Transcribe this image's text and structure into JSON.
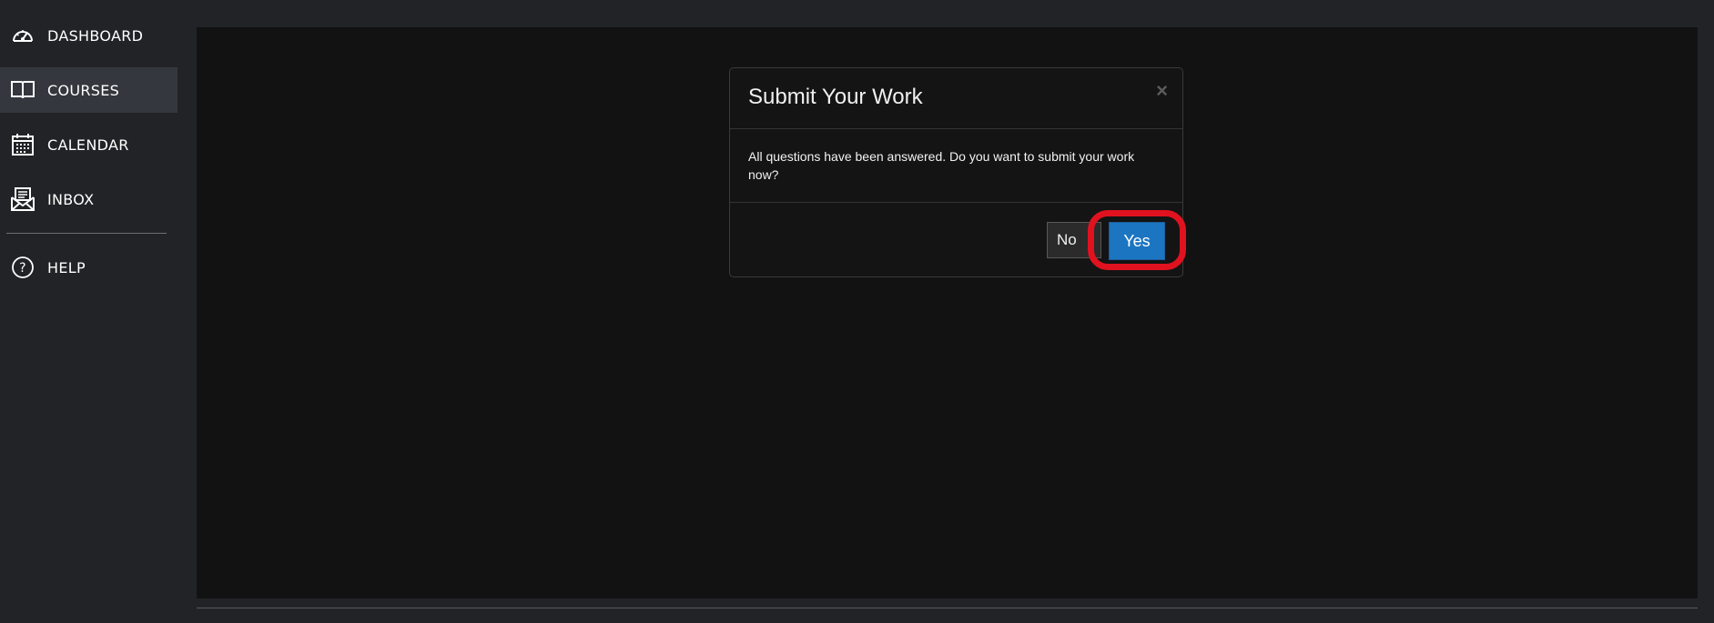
{
  "sidebar": {
    "items": [
      {
        "label": "DASHBOARD",
        "icon": "speedometer-icon"
      },
      {
        "label": "COURSES",
        "icon": "book-icon",
        "active": true
      },
      {
        "label": "CALENDAR",
        "icon": "calendar-icon"
      },
      {
        "label": "INBOX",
        "icon": "inbox-icon"
      },
      {
        "label": "HELP",
        "icon": "help-circle-icon"
      }
    ]
  },
  "modal": {
    "title": "Submit Your Work",
    "close_label": "×",
    "body": "All questions have been answered. Do you want to submit your work now?",
    "no_label": "No",
    "yes_label": "Yes"
  },
  "colors": {
    "sidebar_bg": "#222326",
    "active_item_bg": "#34373d",
    "content_bg": "#121212",
    "primary_button": "#1c75c0",
    "highlight_ring": "#e0121f"
  }
}
